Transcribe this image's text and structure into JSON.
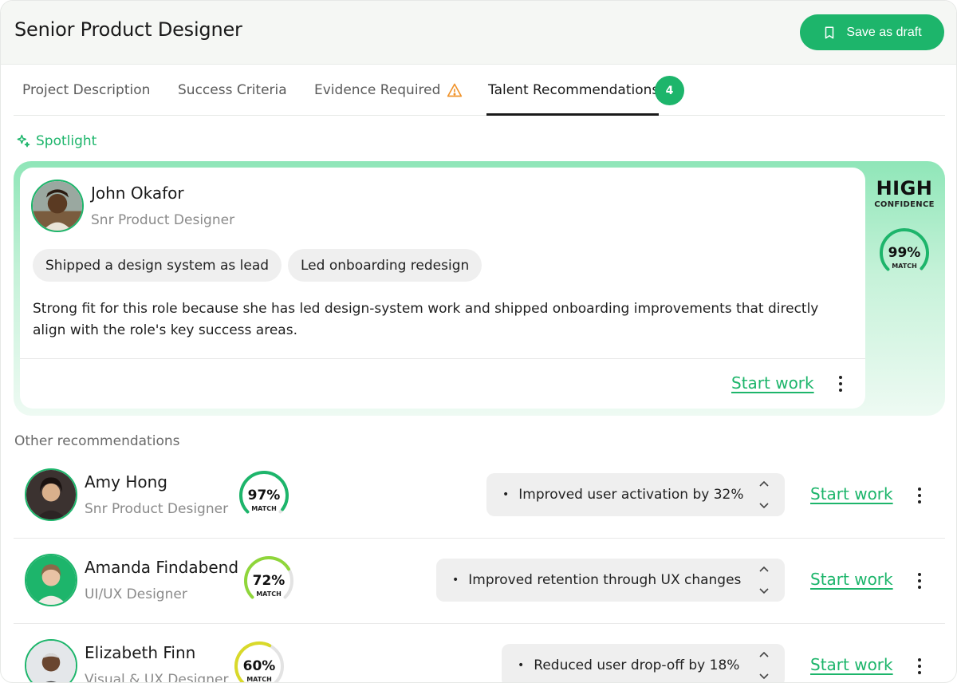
{
  "header": {
    "title": "Senior Product Designer",
    "save_label": "Save as draft"
  },
  "tabs": [
    {
      "label": "Project Description"
    },
    {
      "label": "Success Criteria"
    },
    {
      "label": "Evidence Required"
    },
    {
      "label": "Talent Recommendations",
      "badge": "4",
      "active": true
    }
  ],
  "spotlight": {
    "label": "Spotlight",
    "name": "John Okafor",
    "role": "Snr Product Designer",
    "chips": [
      "Shipped a design system as lead",
      "Led onboarding redesign"
    ],
    "description": "Strong fit for this role because she has led design-system work and shipped onboarding improvements that directly align with the role's key success areas.",
    "start_label": "Start work",
    "confidence_level": "HIGH",
    "confidence_label": "CONFIDENCE",
    "match_value": 99,
    "match_text": "99%",
    "match_label": "MATCH"
  },
  "other": {
    "label": "Other recommendations",
    "rows": [
      {
        "name": "Amy Hong",
        "role": "Snr Product Designer",
        "match_value": 97,
        "match_text": "97%",
        "match_label": "MATCH",
        "highlight": "Improved user activation by 32%",
        "start_label": "Start work",
        "gauge_color": "#1db56b"
      },
      {
        "name": "Amanda Findabend",
        "role": "UI/UX Designer",
        "match_value": 72,
        "match_text": "72%",
        "match_label": "MATCH",
        "highlight": "Improved retention through UX changes",
        "start_label": "Start work",
        "gauge_color": "#8fd63a"
      },
      {
        "name": "Elizabeth Finn",
        "role": "Visual & UX Designer",
        "match_value": 60,
        "match_text": "60%",
        "match_label": "MATCH",
        "highlight": "Reduced user drop-off by 18%",
        "start_label": "Start work",
        "gauge_color": "#d9d92a"
      }
    ]
  },
  "colors": {
    "accent": "#1db56b"
  },
  "icons": {
    "save": "bookmark-icon",
    "warning": "warning-triangle-icon",
    "spotlight": "sparkle-icon",
    "more": "kebab-menu-icon",
    "sort": "chevron-up-down-icon"
  }
}
